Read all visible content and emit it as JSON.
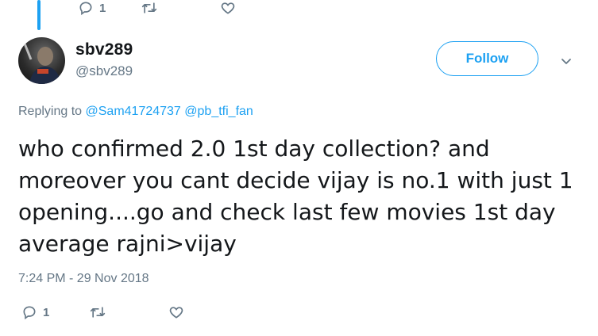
{
  "previous_tweet": {
    "reply_count": "1"
  },
  "tweet": {
    "display_name": "sbv289",
    "handle": "@sbv289",
    "follow_label": "Follow",
    "replying_prefix": "Replying to",
    "mentions": [
      "@Sam41724737",
      "@pb_tfi_fan"
    ],
    "text": "who confirmed 2.0 1st day collection? and moreover you cant decide vijay is no.1 with just 1 opening....go and check last few movies 1st day average rajni>vijay",
    "timestamp": "7:24 PM - 29 Nov 2018",
    "reply_count": "1"
  },
  "colors": {
    "accent": "#1da1f2",
    "muted": "#657786",
    "text": "#14171a"
  },
  "icons": [
    "reply-icon",
    "retweet-icon",
    "like-icon",
    "chevron-down-icon"
  ]
}
